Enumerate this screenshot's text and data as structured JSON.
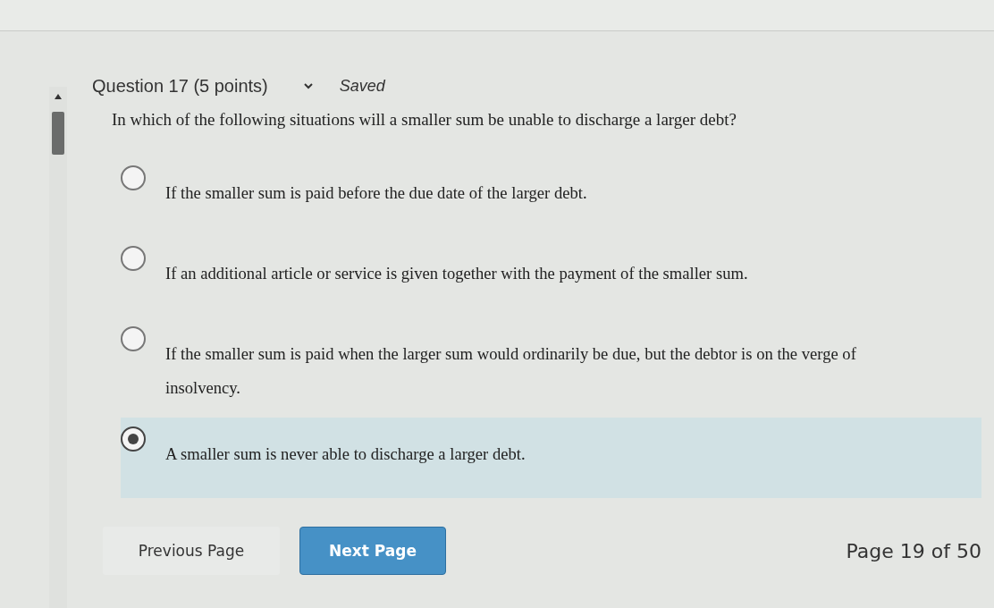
{
  "header": {
    "title": "Question 17 (5 points)",
    "status": "Saved"
  },
  "question": "In which of the following situations will a smaller sum be unable to discharge a larger debt?",
  "options": [
    {
      "label": "If the smaller sum is paid before the due date of the larger debt.",
      "selected": false
    },
    {
      "label": "If an additional article or service is given together with the payment of the smaller sum.",
      "selected": false
    },
    {
      "label": "If the smaller sum is paid when the larger sum would ordinarily be due, but the debtor is on the verge of insolvency.",
      "selected": false
    },
    {
      "label": "A smaller sum is never able to discharge a larger debt.",
      "selected": true
    }
  ],
  "buttons": {
    "previous": "Previous Page",
    "next": "Next Page"
  },
  "page_indicator": "Page 19 of 50"
}
